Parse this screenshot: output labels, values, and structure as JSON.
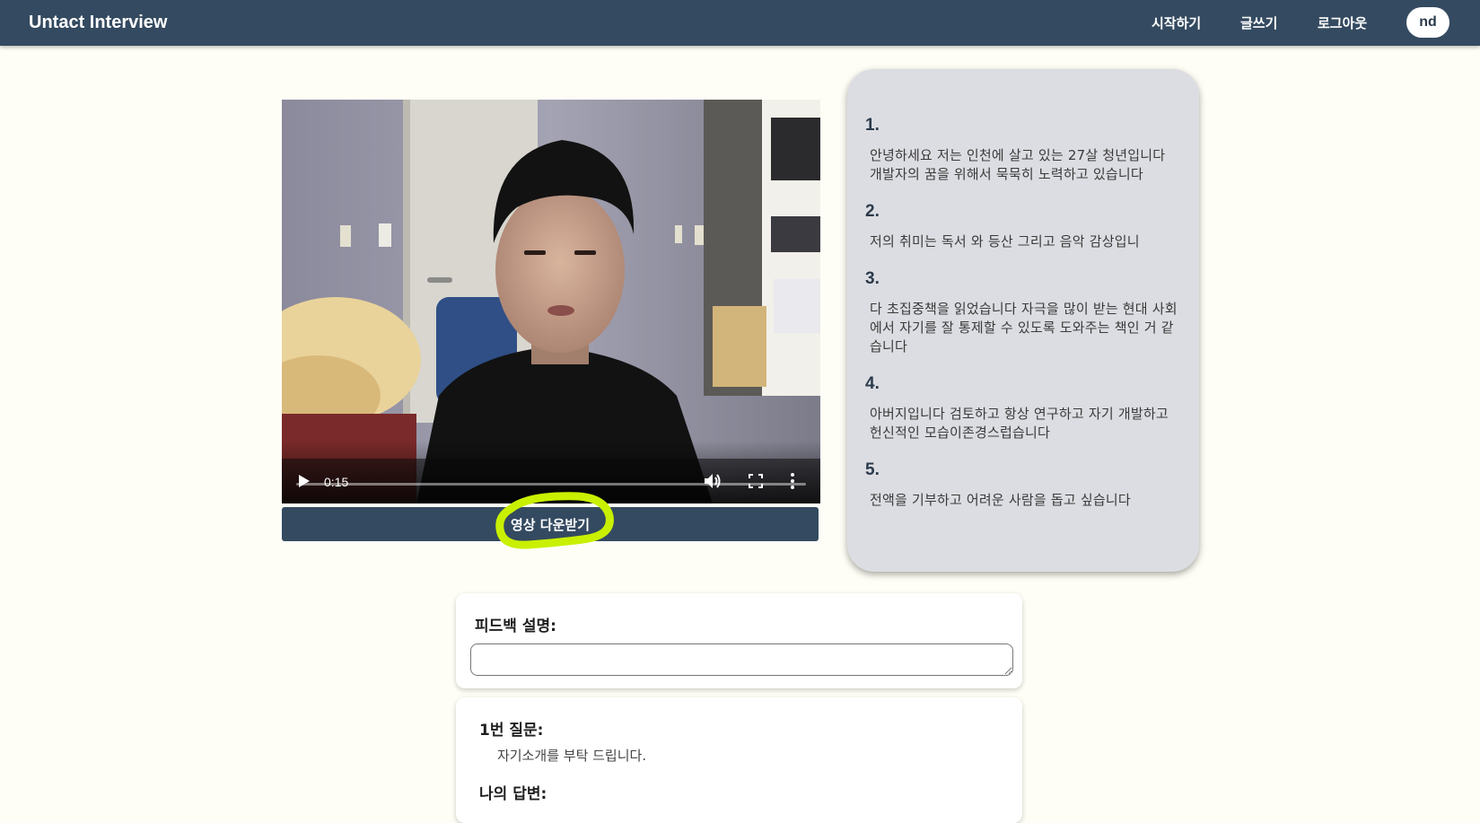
{
  "navbar": {
    "brand": "Untact Interview",
    "links": [
      "시작하기",
      "글쓰기",
      "로그아웃"
    ],
    "avatar": "nd"
  },
  "video": {
    "current_time": "0:15",
    "icons": [
      "play-icon",
      "volume-icon",
      "fullscreen-icon",
      "more-vertical-icon"
    ]
  },
  "download_button": "영상 다운받기",
  "answers": [
    {
      "num": "1.",
      "text": "안녕하세요 저는 인천에 살고 있는 27살 청년입니다 개발자의 꿈을 위해서 묵묵히 노력하고 있습니다"
    },
    {
      "num": "2.",
      "text": "저의 취미는 독서 와 등산 그리고 음악 감상입니"
    },
    {
      "num": "3.",
      "text": "다 초집중책을 읽었습니다 자극을 많이 받는 현대 사회에서 자기를 잘 통제할 수 있도록 도와주는 책인 거 같습니다"
    },
    {
      "num": "4.",
      "text": "아버지입니다 검토하고 항상 연구하고 자기 개발하고 헌신적인 모습이존경스럽습니다"
    },
    {
      "num": "5.",
      "text": "전액을 기부하고 어려운 사람을 돕고 싶습니다"
    }
  ],
  "feedback": {
    "label": "피드백 설명:",
    "value": ""
  },
  "question": {
    "label": "1번 질문:",
    "text": "자기소개를 부탁 드립니다.",
    "answer_label": "나의 답변:"
  },
  "colors": {
    "navbar": "#344a60",
    "background": "#fefef6",
    "answer_panel": "#dcdde2",
    "highlight": "#c8f000"
  }
}
